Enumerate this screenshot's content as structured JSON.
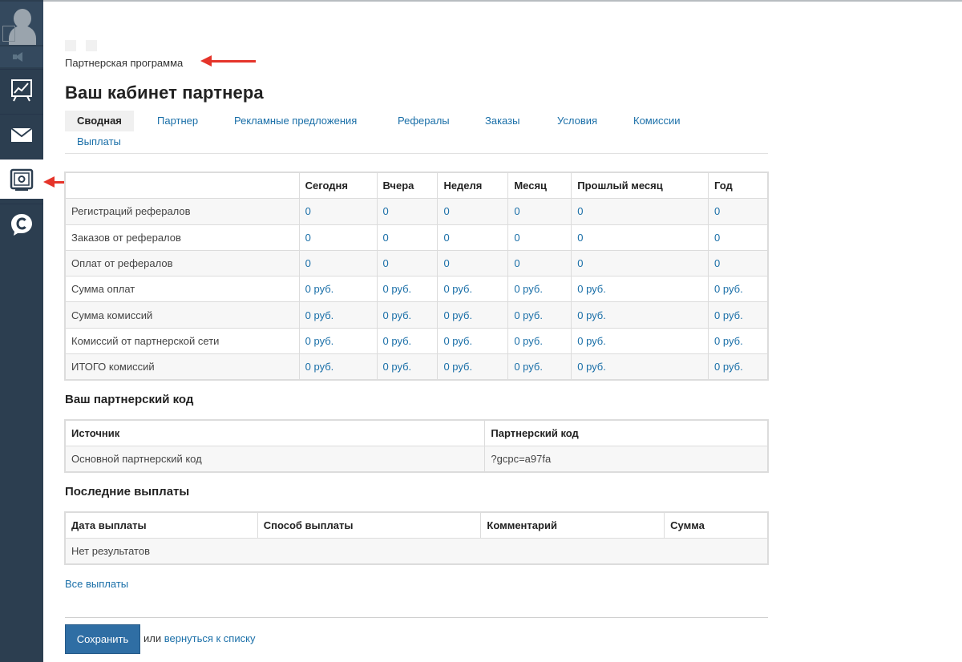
{
  "breadcrumb": {
    "label": "Партнерская программа"
  },
  "page_title": "Ваш кабинет партнера",
  "tabs": [
    {
      "label": "Сводная",
      "active": true
    },
    {
      "label": "Партнер"
    },
    {
      "label": "Рекламные предложения"
    },
    {
      "label": "Рефералы"
    },
    {
      "label": "Заказы"
    },
    {
      "label": "Условия"
    },
    {
      "label": "Комиссии"
    },
    {
      "label": "Выплаты"
    }
  ],
  "stats": {
    "headers": [
      "Сегодня",
      "Вчера",
      "Неделя",
      "Месяц",
      "Прошлый месяц",
      "Год"
    ],
    "rows": [
      {
        "label": "Регистраций рефералов",
        "values": [
          "0",
          "0",
          "0",
          "0",
          "0",
          "0"
        ]
      },
      {
        "label": "Заказов от рефералов",
        "values": [
          "0",
          "0",
          "0",
          "0",
          "0",
          "0"
        ]
      },
      {
        "label": "Оплат от рефералов",
        "values": [
          "0",
          "0",
          "0",
          "0",
          "0",
          "0"
        ]
      },
      {
        "label": "Сумма оплат",
        "values": [
          "0 руб.",
          "0 руб.",
          "0 руб.",
          "0 руб.",
          "0 руб.",
          "0 руб."
        ]
      },
      {
        "label": "Сумма комиссий",
        "values": [
          "0 руб.",
          "0 руб.",
          "0 руб.",
          "0 руб.",
          "0 руб.",
          "0 руб."
        ]
      },
      {
        "label": "Комиссий от партнерской сети",
        "values": [
          "0 руб.",
          "0 руб.",
          "0 руб.",
          "0 руб.",
          "0 руб.",
          "0 руб."
        ]
      },
      {
        "label": "ИТОГО комиссий",
        "values": [
          "0 руб.",
          "0 руб.",
          "0 руб.",
          "0 руб.",
          "0 руб.",
          "0 руб."
        ]
      }
    ]
  },
  "partner_code": {
    "title": "Ваш партнерский код",
    "headers": [
      "Источник",
      "Партнерский код"
    ],
    "row": {
      "source": "Основной партнерский код",
      "code": "?gcpc=a97fa"
    }
  },
  "payouts": {
    "title": "Последние выплаты",
    "headers": [
      "Дата выплаты",
      "Способ выплаты",
      "Комментарий",
      "Сумма"
    ],
    "empty_text": "Нет результатов",
    "all_link": "Все выплаты"
  },
  "footer": {
    "save_label": "Сохранить",
    "or_text": "или",
    "back_link": "вернуться к списку"
  },
  "colors": {
    "sidebar_bg": "#2c3e50",
    "link": "#1a6fa8",
    "save_button": "#2f6ea4",
    "annotation_arrow": "#e5342a"
  },
  "icons": {
    "sidebar": [
      "user-avatar-icon",
      "speaker-icon",
      "chart-icon",
      "mail-icon",
      "safe-icon",
      "chat-c-icon"
    ]
  }
}
